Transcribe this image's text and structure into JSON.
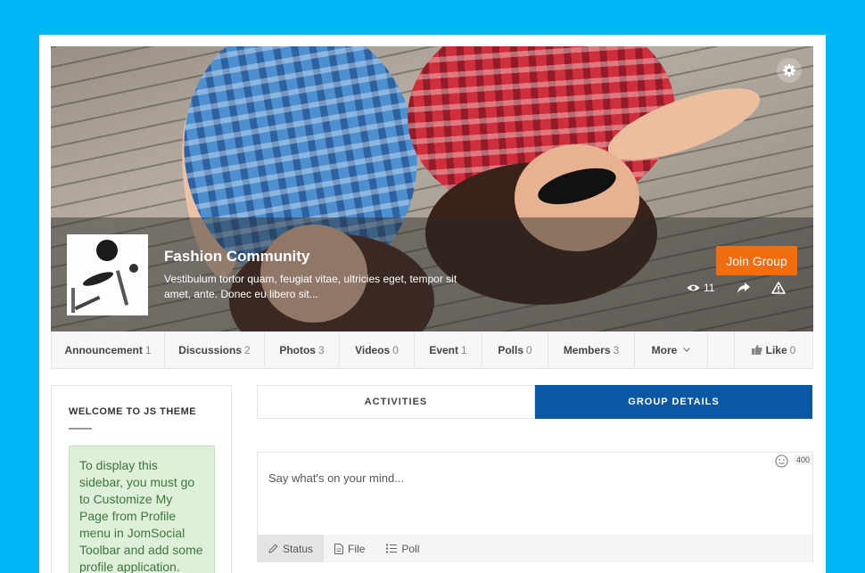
{
  "group": {
    "title": "Fashion Community",
    "description": "Vestibulum tortor quam, feugiat vitae, ultricies eget, tempor sit amet, ante. Donec eu libero sit...",
    "join_label": "Join Group",
    "views": "11"
  },
  "nav": {
    "items": [
      {
        "label": "Announcement",
        "count": "1"
      },
      {
        "label": "Discussions",
        "count": "2"
      },
      {
        "label": "Photos",
        "count": "3"
      },
      {
        "label": "Videos",
        "count": "0"
      },
      {
        "label": "Event",
        "count": "1"
      },
      {
        "label": "Polls",
        "count": "0"
      },
      {
        "label": "Members",
        "count": "3"
      },
      {
        "label": "More",
        "count": ""
      }
    ],
    "like": {
      "label": "Like",
      "count": "0"
    }
  },
  "sidebar": {
    "title": "WELCOME TO JS THEME",
    "notice": "To display this sidebar, you must go to Customize My Page from Profile menu in JomSocial Toolbar and add some profile application."
  },
  "tabs": {
    "activities": "ACTIVITIES",
    "details": "GROUP DETAILS"
  },
  "composer": {
    "placeholder": "Say what's on your mind...",
    "char_limit": "400",
    "tabs": [
      {
        "label": "Status",
        "icon": "pencil-icon"
      },
      {
        "label": "File",
        "icon": "file-icon"
      },
      {
        "label": "Poll",
        "icon": "list-icon"
      }
    ]
  },
  "colors": {
    "background": "#00b6f7",
    "join": "#f26d0d",
    "active_tab": "#0b57a4",
    "notice_bg": "#dff0d8",
    "notice_text": "#3c763d"
  }
}
